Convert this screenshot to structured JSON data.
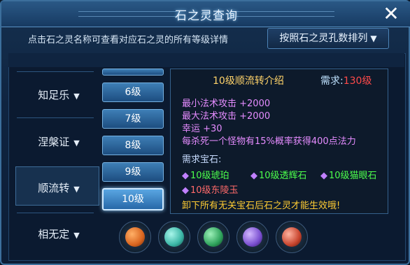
{
  "window": {
    "title": "石之灵查询",
    "close_icon": "close-icon"
  },
  "hint": "点击石之灵名称可查看对应石之灵的所有等级详情",
  "sort_button": {
    "label": "按照石之灵孔数排列"
  },
  "spirits": [
    {
      "name": "知足乐"
    },
    {
      "name": "涅槃证"
    },
    {
      "name": "顺流转",
      "selected": true
    },
    {
      "name": "相无定"
    }
  ],
  "levels": [
    {
      "label": "6级"
    },
    {
      "label": "7级"
    },
    {
      "label": "8级"
    },
    {
      "label": "9级"
    },
    {
      "label": "10级",
      "active": true
    }
  ],
  "detail": {
    "title": "10级顺流转介绍",
    "req_label": "需求:",
    "req_value": "130级",
    "stats": [
      "最小法术攻击 +2000",
      "最大法术攻击 +2000",
      "幸运 +30",
      "每杀死一个怪物有15%概率获得400点法力"
    ],
    "gems_header": "需求宝石:",
    "gems": [
      {
        "name": "10级琥珀"
      },
      {
        "name": "10级透辉石"
      },
      {
        "name": "10级猫眼石"
      },
      {
        "name": "10级东陵玉"
      }
    ],
    "note": "卸下所有无关宝石后石之灵才能生效哦!"
  },
  "gem_slots": [
    {
      "icon": "amber-gem-icon",
      "color": "#d9651f"
    },
    {
      "icon": "diopside-gem-icon",
      "color": "#3bb6a6"
    },
    {
      "icon": "cats-eye-gem-icon",
      "color": "#2fa35c"
    },
    {
      "icon": "purple-gem-icon",
      "color": "#7a4fd0"
    },
    {
      "icon": "red-gem-icon",
      "color": "#c8452e"
    }
  ],
  "colors": {
    "accent": "#5aa6e2",
    "stat_text": "#e58cff",
    "req_value": "#ff4a4a",
    "gem_text": "#4cff4c",
    "note_text": "#ffcc33"
  }
}
